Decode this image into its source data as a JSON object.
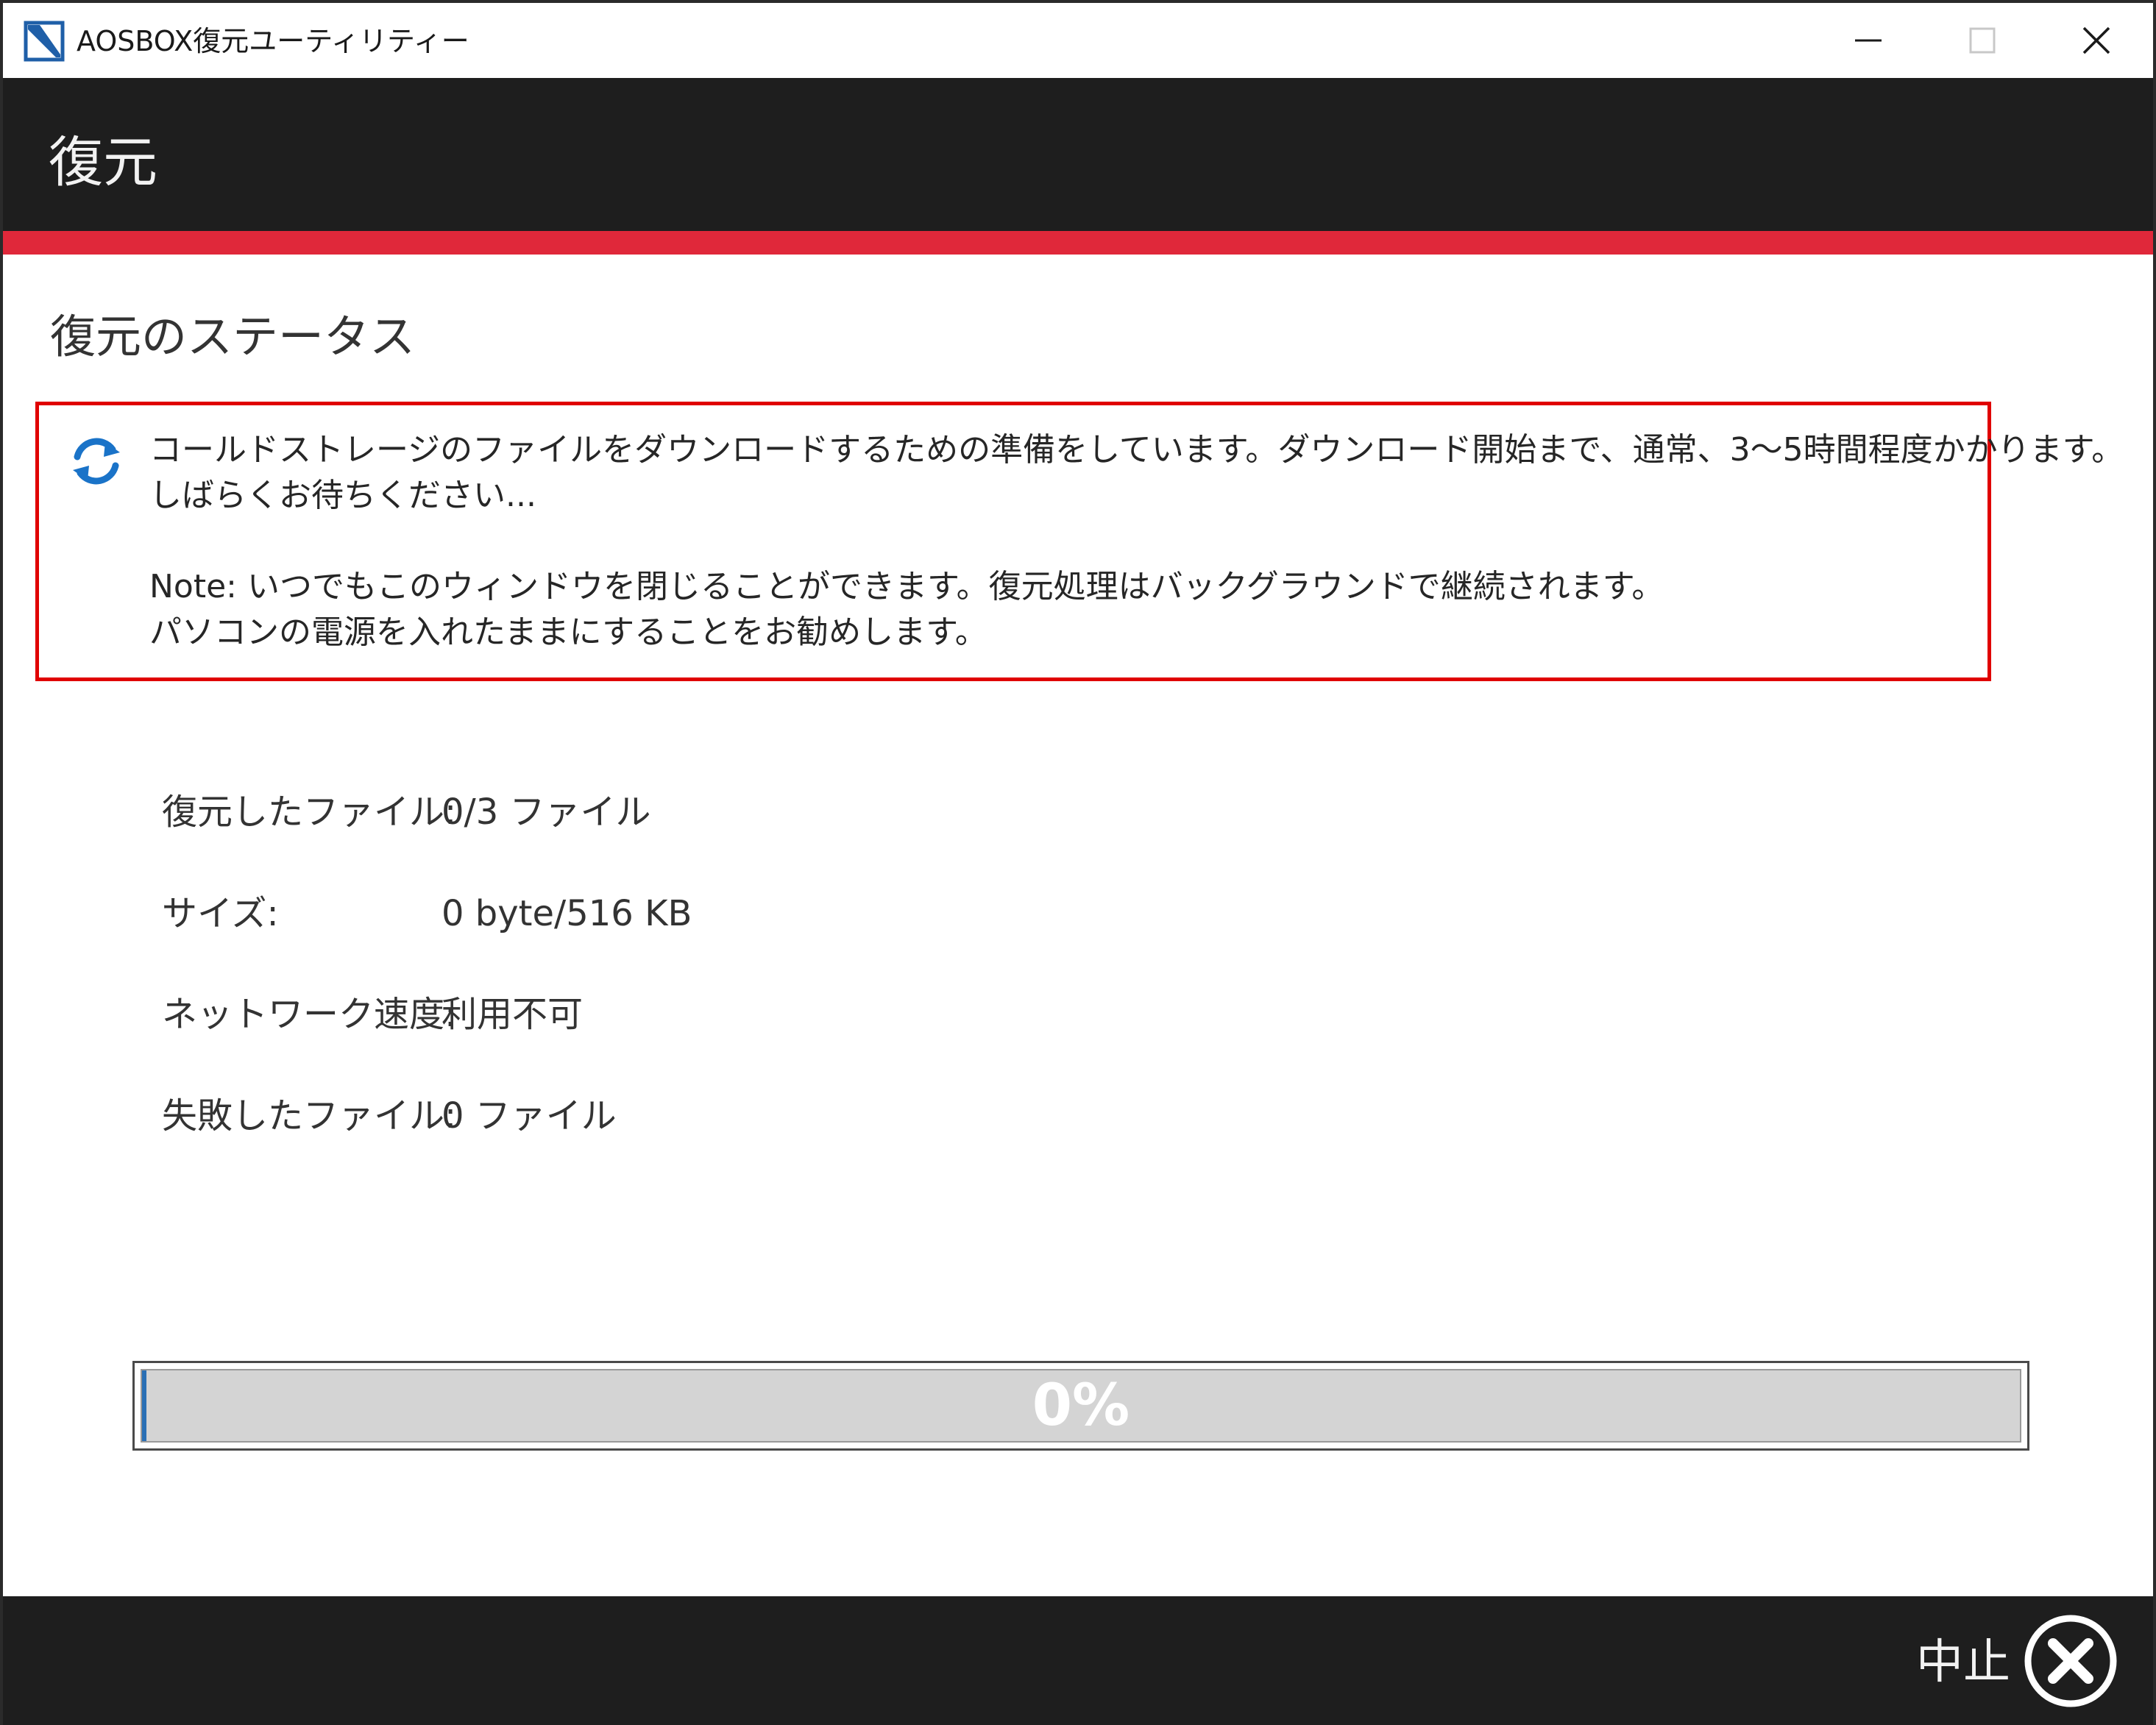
{
  "window": {
    "title": "AOSBOX復元ユーティリティー",
    "controls": {
      "minimize_icon": "minimize-icon",
      "maximize_icon": "maximize-icon",
      "close_icon": "close-icon"
    }
  },
  "header": {
    "title": "復元"
  },
  "status": {
    "section_title": "復元のステータス",
    "notice": {
      "icon": "sync-icon",
      "line1": "コールドストレージのファイルをダウンロードするための準備をしています。ダウンロード開始まで、通常、3〜5時間程度かかります。",
      "line2": "しばらくお待ちください...",
      "line3": "Note: いつでもこのウィンドウを閉じることができます。復元処理はバックグラウンドで継続されます。",
      "line4": "パソコンの電源を入れたままにすることをお勧めします。"
    },
    "rows": [
      {
        "label": "復元したファイル:",
        "value": "0/3 ファイル"
      },
      {
        "label": "サイズ:",
        "value": "0 byte/516 KB"
      },
      {
        "label": "ネットワーク速度:",
        "value": "利用不可"
      },
      {
        "label": "失敗したファイル:",
        "value": "0 ファイル"
      }
    ]
  },
  "progress": {
    "percent": 0,
    "label": "0%"
  },
  "footer": {
    "cancel_label": "中止",
    "cancel_icon": "circle-x-icon"
  },
  "colors": {
    "accent": "#e0283a",
    "notice_border": "#e00000",
    "header_bg": "#1e1e1e",
    "progress_fill": "#2a6fb5"
  }
}
